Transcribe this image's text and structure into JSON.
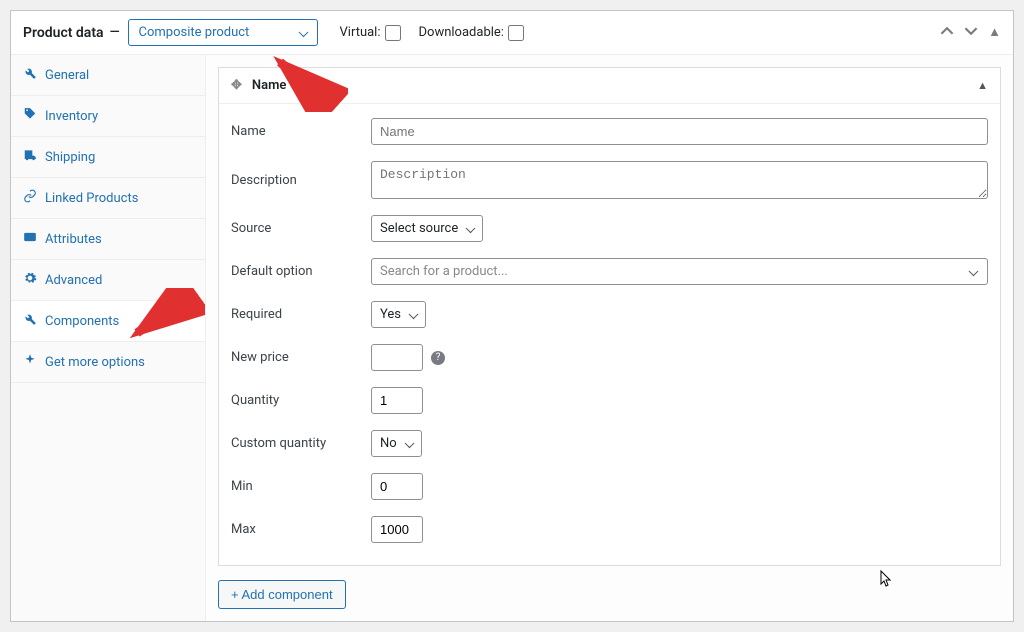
{
  "header": {
    "title": "Product data",
    "product_type": "Composite product",
    "virtual_label": "Virtual:",
    "downloadable_label": "Downloadable:"
  },
  "sidebar": {
    "items": [
      {
        "label": "General",
        "icon": "wrench"
      },
      {
        "label": "Inventory",
        "icon": "tag"
      },
      {
        "label": "Shipping",
        "icon": "truck"
      },
      {
        "label": "Linked Products",
        "icon": "link"
      },
      {
        "label": "Attributes",
        "icon": "card"
      },
      {
        "label": "Advanced",
        "icon": "gear"
      },
      {
        "label": "Components",
        "icon": "wrench",
        "active": true
      },
      {
        "label": "Get more options",
        "icon": "spark"
      }
    ]
  },
  "component": {
    "section_title": "Name",
    "labels": {
      "name": "Name",
      "description": "Description",
      "source": "Source",
      "default_option": "Default option",
      "required": "Required",
      "new_price": "New price",
      "quantity": "Quantity",
      "custom_quantity": "Custom quantity",
      "min": "Min",
      "max": "Max"
    },
    "placeholders": {
      "name": "Name",
      "description": "Description",
      "default_option": "Search for a product..."
    },
    "values": {
      "source": "Select source",
      "required": "Yes",
      "new_price": "",
      "quantity": "1",
      "custom_quantity": "No",
      "min": "0",
      "max": "1000"
    }
  },
  "buttons": {
    "add_component": "+ Add component"
  }
}
